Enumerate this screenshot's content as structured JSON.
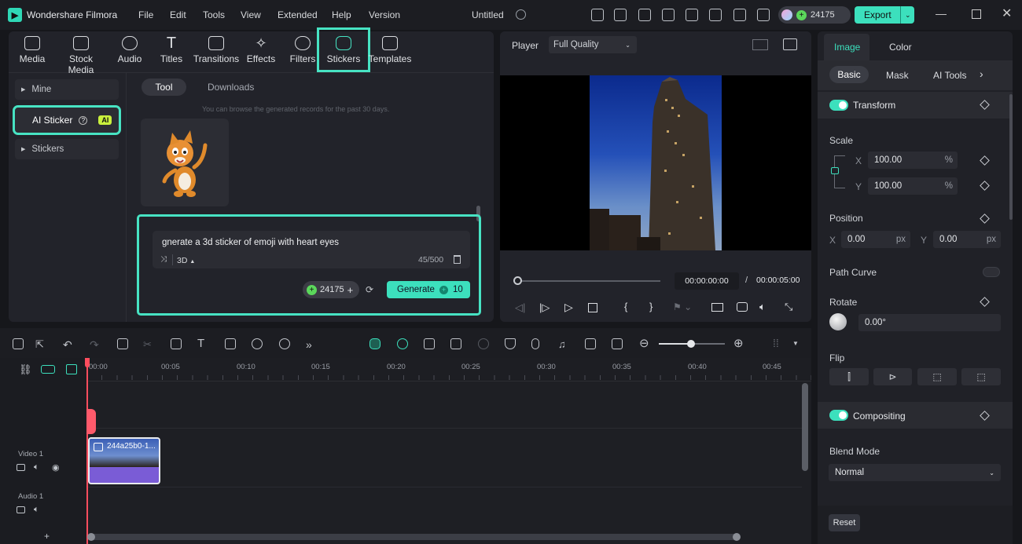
{
  "app": {
    "name": "Wondershare Filmora",
    "project_title": "Untitled",
    "credits": "24175",
    "export_label": "Export"
  },
  "menu": [
    "File",
    "Edit",
    "Tools",
    "View",
    "Extended",
    "Help",
    "Version"
  ],
  "toolbar": [
    {
      "label": "Media",
      "icon": "media-icon"
    },
    {
      "label": "Stock Media",
      "icon": "stock-media-icon"
    },
    {
      "label": "Audio",
      "icon": "music-note-icon"
    },
    {
      "label": "Titles",
      "icon": "text-t-icon"
    },
    {
      "label": "Transitions",
      "icon": "transitions-icon"
    },
    {
      "label": "Effects",
      "icon": "effects-sparkle-icon"
    },
    {
      "label": "Filters",
      "icon": "filters-icon"
    },
    {
      "label": "Stickers",
      "icon": "sticker-icon"
    },
    {
      "label": "Templates",
      "icon": "templates-icon"
    }
  ],
  "sidebar": {
    "items": [
      {
        "label": "Mine"
      },
      {
        "label": "AI Sticker",
        "badge": "AI"
      },
      {
        "label": "Stickers"
      }
    ]
  },
  "sticker_panel": {
    "tabs": [
      "Tool",
      "Downloads"
    ],
    "notice": "You can browse the generated records for the past 30 days.",
    "prompt": "gnerate a 3d sticker of emoji with heart eyes",
    "style": "3D",
    "char_count": "45/500",
    "credits": "24175",
    "generate_label": "Generate",
    "generate_cost": "10"
  },
  "player": {
    "label": "Player",
    "quality": "Full Quality",
    "current_time": "00:00:00:00",
    "separator": "/",
    "total_time": "00:00:05:00"
  },
  "inspector": {
    "tabs": [
      "Image",
      "Color"
    ],
    "subtabs": [
      "Basic",
      "Mask",
      "AI Tools"
    ],
    "transform_label": "Transform",
    "scale_label": "Scale",
    "scale_x": "100.00",
    "scale_y": "100.00",
    "percent": "%",
    "x_label": "X",
    "y_label": "Y",
    "position_label": "Position",
    "pos_x": "0.00",
    "pos_y": "0.00",
    "px": "px",
    "path_curve_label": "Path Curve",
    "rotate_label": "Rotate",
    "rotate_value": "0.00°",
    "flip_label": "Flip",
    "compositing_label": "Compositing",
    "blend_mode_label": "Blend Mode",
    "blend_mode": "Normal",
    "reset_label": "Reset"
  },
  "timeline": {
    "ruler": [
      "00:00",
      "00:05",
      "00:10",
      "00:15",
      "00:20",
      "00:25",
      "00:30",
      "00:35",
      "00:40",
      "00:45"
    ],
    "tracks": [
      {
        "label": "Video 1"
      },
      {
        "label": "Audio 1"
      }
    ],
    "clip_name": "244a25b0-1..."
  },
  "colors": {
    "accent": "#3ce0bd",
    "highlight": "#47e3c3",
    "clip": "#7a5cd6",
    "playhead": "#ff4d5e"
  }
}
